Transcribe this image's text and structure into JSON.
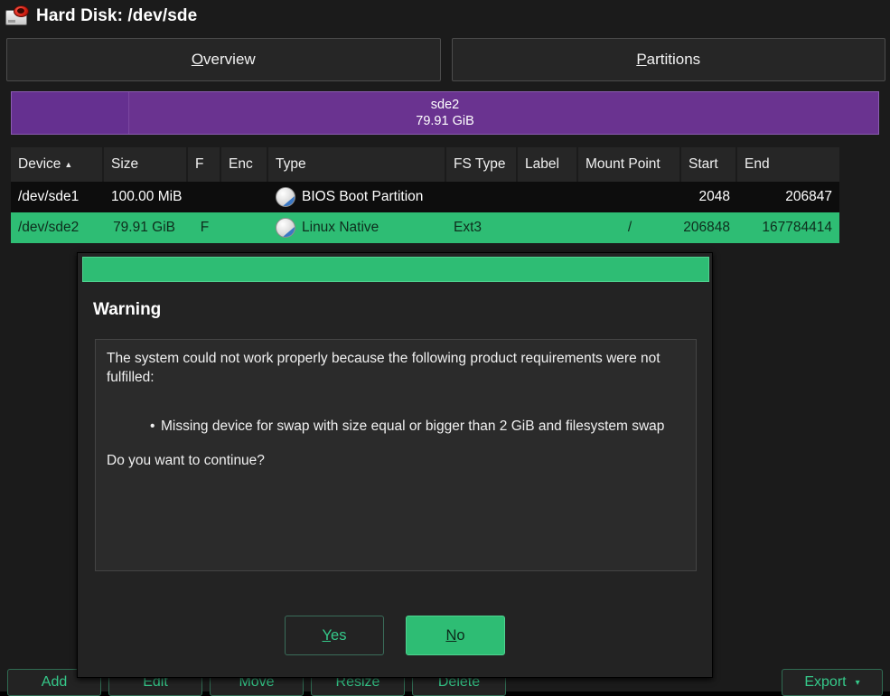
{
  "window": {
    "title": "Hard Disk: /dev/sde",
    "icon": "hard-disk-icon"
  },
  "tabs": [
    {
      "label": "Overview",
      "accesskey": "O",
      "selected": false
    },
    {
      "label": "Partitions",
      "accesskey": "P",
      "selected": true
    }
  ],
  "disk_bar": {
    "name": "sde2",
    "size": "79.91 GiB",
    "color": "#6a3390"
  },
  "table": {
    "columns": [
      {
        "label": "Device",
        "sorted": true,
        "sort_arrow": "▲"
      },
      {
        "label": "Size"
      },
      {
        "label": "F"
      },
      {
        "label": "Enc"
      },
      {
        "label": "Type"
      },
      {
        "label": "FS Type"
      },
      {
        "label": "Label"
      },
      {
        "label": "Mount Point"
      },
      {
        "label": "Start"
      },
      {
        "label": "End"
      }
    ],
    "rows": [
      {
        "selected": false,
        "device": "/dev/sde1",
        "size": "100.00 MiB",
        "f": "",
        "enc": "",
        "type": "BIOS Boot Partition",
        "fs_type": "",
        "label": "",
        "mount_point": "",
        "start": "2048",
        "end": "206847"
      },
      {
        "selected": true,
        "device": "/dev/sde2",
        "size": "79.91 GiB",
        "f": "F",
        "enc": "",
        "type": "Linux Native",
        "fs_type": "Ext3",
        "label": "",
        "mount_point": "/",
        "start": "206848",
        "end": "167784414"
      }
    ]
  },
  "toolbar": {
    "buttons": [
      {
        "label": "Add"
      },
      {
        "label": "Edit"
      },
      {
        "label": "Move"
      },
      {
        "label": "Resize"
      },
      {
        "label": "Delete"
      }
    ],
    "export": {
      "label": "Export",
      "caret": "▾"
    }
  },
  "dialog": {
    "heading": "Warning",
    "paragraph": "The system could not work properly because the following product requirements were not fulfilled:",
    "bullets": [
      "Missing device for swap with size equal or bigger than 2 GiB and filesystem swap"
    ],
    "question": "Do you want to continue?",
    "buttons": {
      "yes": {
        "label": "Yes",
        "accesskey": "Y"
      },
      "no": {
        "label": "No",
        "accesskey": "N"
      }
    },
    "accent_color": "#2ebd74"
  }
}
